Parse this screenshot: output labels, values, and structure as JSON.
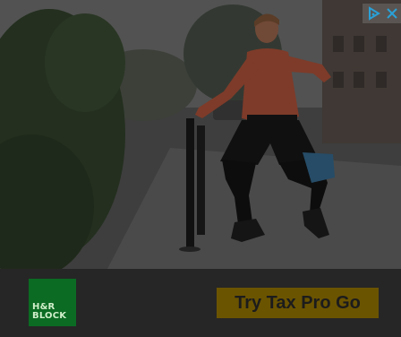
{
  "ad": {
    "cta_label": "Try Tax Pro Go",
    "logo": {
      "line1": "H&R",
      "line2": "BLOCK",
      "color": "#0b6b23"
    },
    "cta_color": "#6b5400",
    "overlay_icons": [
      "adchoices-icon",
      "close-icon"
    ]
  }
}
